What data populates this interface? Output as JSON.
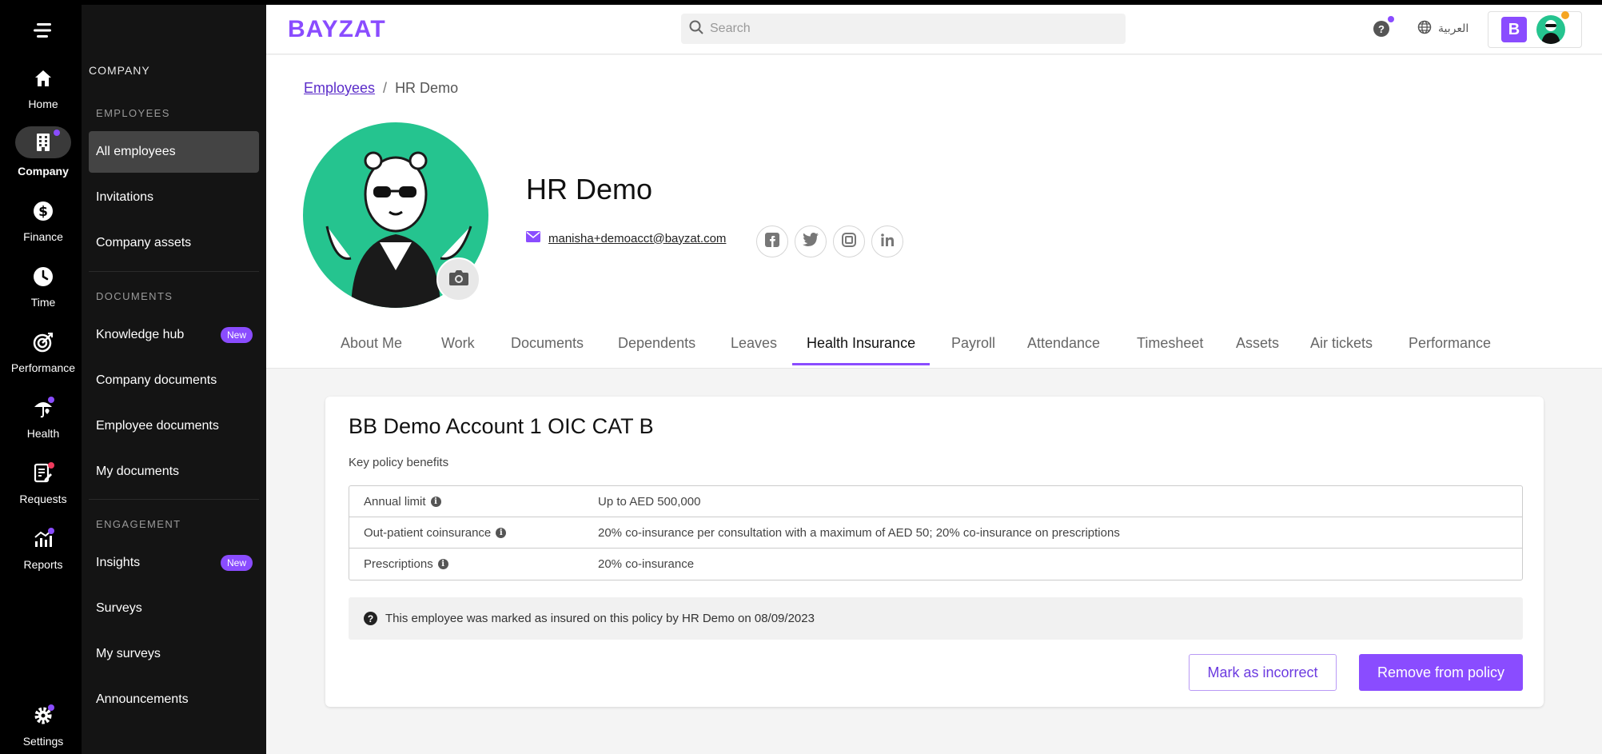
{
  "rail": {
    "items": [
      {
        "label": "Home",
        "icon": "home-icon"
      },
      {
        "label": "Company",
        "icon": "building-icon"
      },
      {
        "label": "Finance",
        "icon": "dollar-icon"
      },
      {
        "label": "Time",
        "icon": "clock-icon"
      },
      {
        "label": "Performance",
        "icon": "target-icon"
      },
      {
        "label": "Health",
        "icon": "health-icon"
      },
      {
        "label": "Requests",
        "icon": "request-icon"
      },
      {
        "label": "Reports",
        "icon": "chart-icon"
      },
      {
        "label": "Settings",
        "icon": "gear-icon"
      }
    ]
  },
  "sidebar": {
    "heading": "COMPANY",
    "sections": {
      "employees": "EMPLOYEES",
      "documents": "DOCUMENTS",
      "engagement": "ENGAGEMENT"
    },
    "items": {
      "all_employees": "All employees",
      "invitations": "Invitations",
      "company_assets": "Company assets",
      "knowledge_hub": "Knowledge hub",
      "company_documents": "Company documents",
      "employee_documents": "Employee documents",
      "my_documents": "My documents",
      "insights": "Insights",
      "surveys": "Surveys",
      "my_surveys": "My surveys",
      "announcements": "Announcements"
    },
    "badge_new": "New"
  },
  "topbar": {
    "logo": "BAYZAT",
    "search_placeholder": "Search",
    "help": "?",
    "language": "العربية",
    "account_initial": "B"
  },
  "breadcrumb": {
    "root": "Employees",
    "current": "HR Demo"
  },
  "profile": {
    "name": "HR Demo",
    "email": "manisha+demoacct@bayzat.com"
  },
  "tabs": [
    "About Me",
    "Work",
    "Documents",
    "Dependents",
    "Leaves",
    "Health Insurance",
    "Payroll",
    "Attendance",
    "Timesheet",
    "Assets",
    "Air tickets",
    "Performance"
  ],
  "active_tab": "Health Insurance",
  "policy": {
    "title": "BB Demo Account 1 OIC CAT B",
    "subtitle": "Key policy benefits",
    "benefits": [
      {
        "name": "Annual limit",
        "value": "Up to AED 500,000"
      },
      {
        "name": "Out-patient coinsurance",
        "value": "20% co-insurance per consultation with a maximum of AED 50; 20% co-insurance on prescriptions"
      },
      {
        "name": "Prescriptions",
        "value": "20% co-insurance"
      }
    ],
    "notice": "This employee was marked as insured on this policy by HR Demo on 08/09/2023",
    "mark_incorrect": "Mark as incorrect",
    "remove": "Remove from policy"
  },
  "colors": {
    "accent": "#8a4cff",
    "avatar_bg": "#25c48f"
  }
}
